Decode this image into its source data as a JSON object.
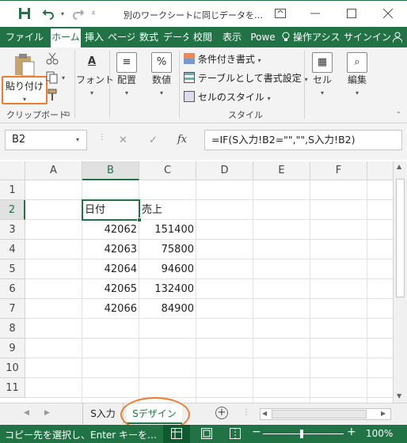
{
  "titlebar": {
    "title": "別のワークシートに同じデータを…",
    "save_icon": "save-icon",
    "undo_icon": "undo-icon",
    "redo_icon": "redo-icon"
  },
  "tabs": [
    "ファイル",
    "ホーム",
    "挿入",
    "ページ",
    "数式",
    "データ",
    "校閲",
    "表示",
    "Powe",
    "操作アシス",
    "サインイン"
  ],
  "ribbon": {
    "paste_label": "貼り付け",
    "font_label": "フォント",
    "align_label": "配置",
    "number_label": "数値",
    "number_icon": "%",
    "cond_format": "条件付き書式",
    "table_format": "テーブルとして書式設定",
    "cell_style": "セルのスタイル",
    "cell_label": "セル",
    "edit_label": "編集",
    "group_clipboard": "クリップボード",
    "group_style": "スタイル"
  },
  "formula_bar": {
    "name_box": "B2",
    "cancel": "✕",
    "enter": "✓",
    "fx": "fx",
    "formula": "=IF(S入力!B2=\"\",\"\",S入力!B2)"
  },
  "grid": {
    "columns": [
      "A",
      "B",
      "C",
      "D",
      "E",
      "F"
    ],
    "rows": [
      "1",
      "2",
      "3",
      "4",
      "5",
      "6",
      "7",
      "8",
      "9",
      "10",
      "11"
    ],
    "b2": "日付",
    "c2": "売上",
    "data": [
      [
        "42062",
        "151400"
      ],
      [
        "42063",
        "75800"
      ],
      [
        "42064",
        "94600"
      ],
      [
        "42065",
        "132400"
      ],
      [
        "42066",
        "84900"
      ]
    ]
  },
  "sheets": {
    "tab1": "S入力",
    "tab2": "Sデザイン"
  },
  "status": {
    "message": "コピー先を選択し、Enter キーを…",
    "zoom": "100%"
  },
  "colors": {
    "accent": "#217346",
    "highlight": "#ed7d31"
  }
}
